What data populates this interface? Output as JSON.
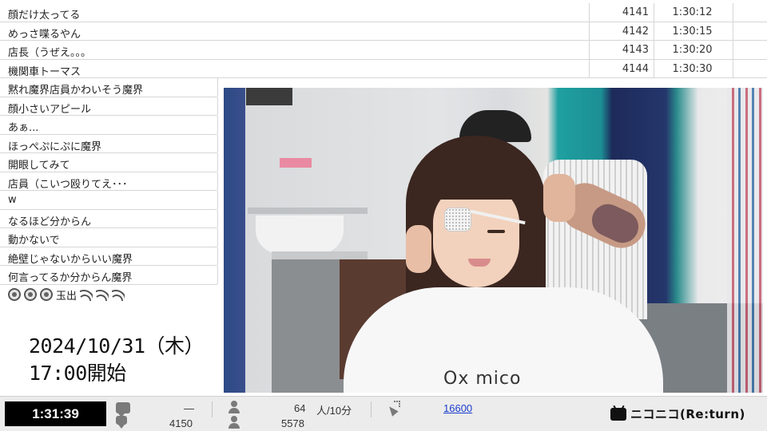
{
  "comments_top": [
    {
      "text": "顔だけ太ってる",
      "no": "4141",
      "time": "1:30:12"
    },
    {
      "text": "めっさ喋るやん",
      "no": "4142",
      "time": "1:30:15"
    },
    {
      "text": "店長（うぜえ。。。",
      "no": "4143",
      "time": "1:30:20"
    },
    {
      "text": "機関車トーマス",
      "no": "4144",
      "time": "1:30:30"
    }
  ],
  "comments_side": [
    "黙れ魔界店員かわいそう魔界",
    "顔小さいアピール",
    "あぁ...",
    "ほっぺぷにぷに魔界",
    "開眼してみて",
    "店員（こいつ殴りてえ･･･",
    "w",
    "なるほど分からん",
    "動かないで",
    "絶壁じゃないからいい魔界",
    "何言ってるか分からん魔界"
  ],
  "emoji_row": {
    "text": "玉出"
  },
  "date_caption": {
    "line1": "2024/10/31（木）",
    "line2": "17:00開始"
  },
  "video": {
    "cape_text": "Ox mico"
  },
  "statusbar": {
    "elapsed": "1:31:39",
    "comment_dash": "—",
    "comment_count": "4150",
    "viewers_per_10min": "64",
    "viewers_unit": "人/10分",
    "total_viewers": "5578",
    "ad_points": "16600",
    "brand": "ニコニコ(Re:turn)"
  },
  "icons": {
    "comment": "speech-bubble-icon",
    "viewer": "person-icon",
    "ad": "party-popper-icon",
    "brand": "niconico-tv-icon"
  }
}
